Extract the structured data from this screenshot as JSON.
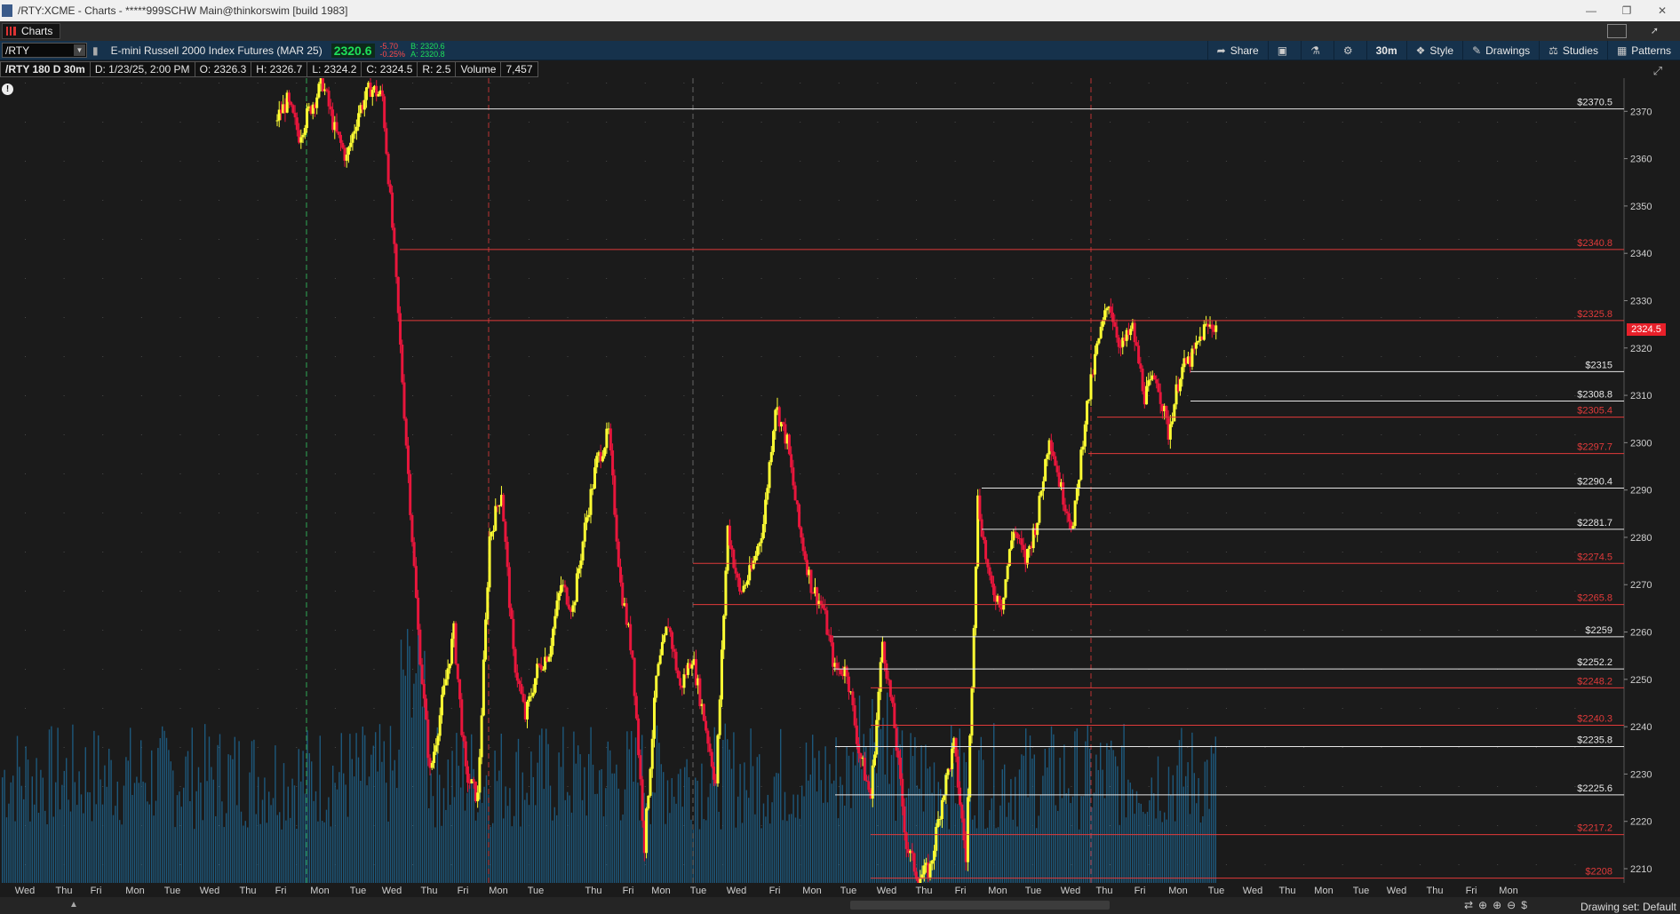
{
  "window": {
    "title": "/RTY:XCME - Charts - *****999SCHW Main@thinkorswim [build 1983]",
    "minimize_icon": "minimize-icon",
    "maximize_icon": "maximize-icon",
    "close_icon": "close-icon"
  },
  "tab": {
    "label": "Charts"
  },
  "toolbar": {
    "symbol": "/RTY",
    "description": "E-mini Russell 2000 Index Futures (MAR 25)",
    "last": "2320.6",
    "change": "-5.70",
    "change_pct": "-0.25%",
    "bid": "B: 2320.6",
    "ask": "A: 2320.8",
    "share": "Share",
    "timeframe": "30m",
    "style": "Style",
    "drawings": "Drawings",
    "studies": "Studies",
    "patterns": "Patterns"
  },
  "info": {
    "chart_id": "/RTY 180 D 30m",
    "date": "D: 1/23/25, 2:00 PM",
    "open": "O: 2326.3",
    "high": "H: 2326.7",
    "low": "L: 2324.2",
    "close": "C: 2324.5",
    "range": "R: 2.5",
    "volume_label": "Volume",
    "volume_value": "7,457"
  },
  "last_price_badge": "2324.5",
  "colors": {
    "bull": "#ffff33",
    "bear": "#e8163c",
    "volume": "#1f6e9c",
    "level_white": "#e6e6e6",
    "level_red": "#e03a3a",
    "background": "#1b1b1b"
  },
  "chart_data": {
    "type": "candlestick",
    "ylim": [
      2207,
      2377
    ],
    "yticks": [
      2370,
      2360,
      2350,
      2340,
      2330,
      2320,
      2310,
      2300,
      2290,
      2280,
      2270,
      2260,
      2250,
      2240,
      2230,
      2220,
      2210
    ],
    "xlabels": [
      "Wed",
      "Thu",
      "Fri",
      "Mon",
      "Tue",
      "Wed",
      "Thu",
      "Fri",
      "Mon",
      "Tue",
      "Wed",
      "Thu",
      "Fri",
      "Mon",
      "Tue",
      "Thu",
      "Fri",
      "Mon",
      "Tue",
      "Wed",
      "Fri",
      "Mon",
      "Tue",
      "Wed",
      "Thu",
      "Fri",
      "Mon",
      "Tue",
      "Wed",
      "Thu",
      "Fri",
      "Mon",
      "Tue",
      "Wed",
      "Thu",
      "Mon",
      "Tue",
      "Wed",
      "Thu",
      "Fri",
      "Mon"
    ],
    "levels": [
      {
        "label": "$2370.5",
        "value": 2370.5,
        "color": "white"
      },
      {
        "label": "$2340.8",
        "value": 2340.8,
        "color": "red"
      },
      {
        "label": "$2325.8",
        "value": 2325.8,
        "color": "red"
      },
      {
        "label": "$2315",
        "value": 2315,
        "color": "white"
      },
      {
        "label": "$2308.8",
        "value": 2308.8,
        "color": "white"
      },
      {
        "label": "$2305.4",
        "value": 2305.4,
        "color": "red"
      },
      {
        "label": "$2297.7",
        "value": 2297.7,
        "color": "red"
      },
      {
        "label": "$2290.4",
        "value": 2290.4,
        "color": "white"
      },
      {
        "label": "$2281.7",
        "value": 2281.7,
        "color": "white"
      },
      {
        "label": "$2274.5",
        "value": 2274.5,
        "color": "red"
      },
      {
        "label": "$2265.8",
        "value": 2265.8,
        "color": "red"
      },
      {
        "label": "$2259",
        "value": 2259,
        "color": "white"
      },
      {
        "label": "$2252.2",
        "value": 2252.2,
        "color": "white"
      },
      {
        "label": "$2248.2",
        "value": 2248.2,
        "color": "red"
      },
      {
        "label": "$2240.3",
        "value": 2240.3,
        "color": "red"
      },
      {
        "label": "$2235.8",
        "value": 2235.8,
        "color": "white"
      },
      {
        "label": "$2225.6",
        "value": 2225.6,
        "color": "white"
      },
      {
        "label": "$2217.2",
        "value": 2217.2,
        "color": "red"
      },
      {
        "label": "$2208",
        "value": 2208,
        "color": "red"
      }
    ],
    "price_path": [
      2368,
      2372,
      2365,
      2371,
      2376,
      2366,
      2360,
      2370,
      2375,
      2373,
      2340,
      2300,
      2260,
      2230,
      2245,
      2260,
      2230,
      2225,
      2280,
      2290,
      2255,
      2242,
      2252,
      2256,
      2270,
      2265,
      2282,
      2296,
      2302,
      2270,
      2255,
      2215,
      2250,
      2262,
      2248,
      2255,
      2242,
      2228,
      2282,
      2268,
      2273,
      2283,
      2308,
      2300,
      2282,
      2270,
      2265,
      2252,
      2252,
      2235,
      2225,
      2258,
      2240,
      2215,
      2208,
      2210,
      2225,
      2236,
      2212,
      2288,
      2270,
      2266,
      2282,
      2275,
      2284,
      2302,
      2290,
      2282,
      2305,
      2320,
      2330,
      2320,
      2324,
      2310,
      2314,
      2302,
      2315,
      2318,
      2324,
      2325
    ],
    "path_x_start": 0.165,
    "path_x_end": 0.725,
    "session_markers": [
      "2024 year"
    ]
  },
  "status": {
    "drawing_set": "Drawing set: Default"
  }
}
